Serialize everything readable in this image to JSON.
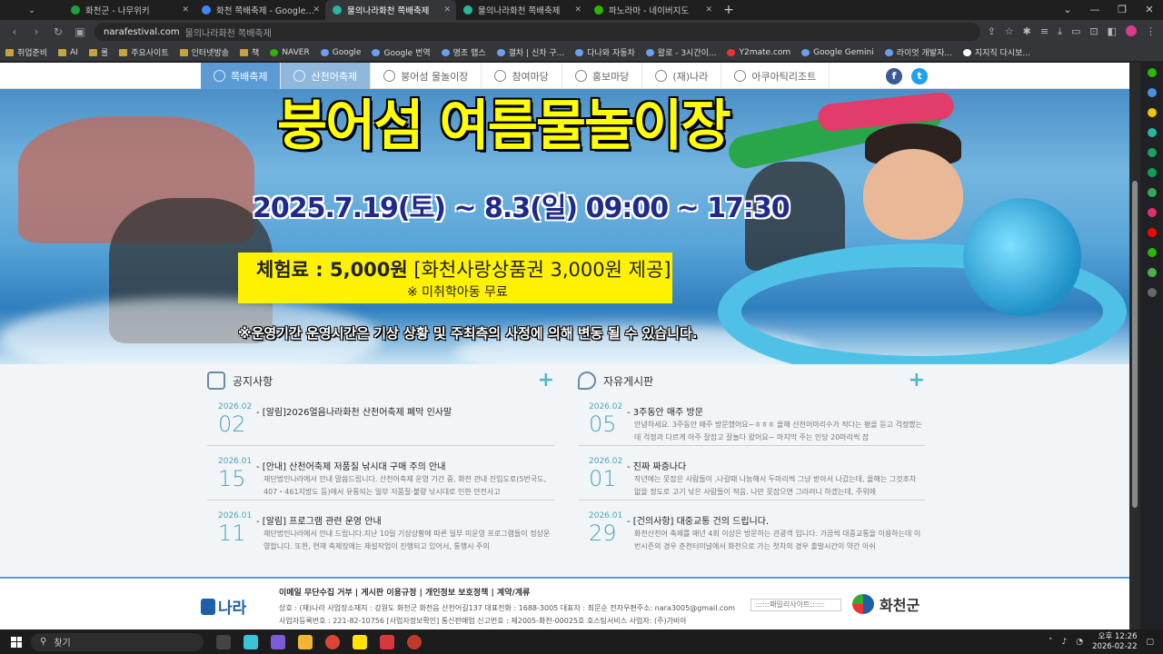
{
  "browser": {
    "tabs": [
      {
        "title": "화천군 - 나무위키",
        "color": "#18a33a",
        "active": false
      },
      {
        "title": "화천 쪽배축제 - Google 검색",
        "color": "#4285f4",
        "active": false
      },
      {
        "title": "물의나라화천 쪽배축제",
        "color": "#27b6a0",
        "active": true
      },
      {
        "title": "물의나라화천 쪽배축제",
        "color": "#27b6a0",
        "active": false
      },
      {
        "title": "파노라마 - 네이버지도",
        "color": "#2db400",
        "active": false
      }
    ],
    "new_tab": "+",
    "address": {
      "host": "narafestival.com",
      "path": "물의나라화천 쪽배축제"
    },
    "bookmarks": [
      "취업준비",
      "AI",
      "롤",
      "주요사이트",
      "인터넷방송",
      "책",
      "NAVER",
      "Google",
      "Google 번역",
      "명조 맵스",
      "갤차 | 신차 구...",
      "다나와 자동차",
      "왈로 - 3시간이...",
      "Y2mate.com",
      "Google Gemini",
      "라이엇 개발자...",
      "지지직 다시보..."
    ]
  },
  "site": {
    "nav": [
      {
        "label": "쪽배축제",
        "icon": "boat-icon"
      },
      {
        "label": "산천어축제",
        "icon": "fish-icon"
      },
      {
        "label": "붕어섬 물놀이장",
        "icon": "sun-icon"
      },
      {
        "label": "참여마당",
        "icon": "people-icon"
      },
      {
        "label": "홍보마당",
        "icon": "mic-icon"
      },
      {
        "label": "(재)나라",
        "icon": "building-icon"
      },
      {
        "label": "아쿠아틱리조트",
        "icon": "resort-icon"
      }
    ],
    "social": {
      "facebook": "f",
      "twitter": "t"
    },
    "hero": {
      "title": "붕어섬 여름물놀이장",
      "date": "2025.7.19(토) ~ 8.3(일) 09:00 ~ 17:30",
      "fee_bold": "체험료 : 5,000원",
      "fee_rest": " [화천사랑상품권 3,000원 제공]",
      "fee_note": "※ 미취학아동 무료",
      "notice": "※운영기간 운영시간은 기상 상황 및 주최측의 사정에 의해 변동 될 수 있습니다."
    },
    "notice_board": {
      "title": "공지사항",
      "plus": "+",
      "posts": [
        {
          "ym": "2026.02",
          "dd": "02",
          "title": "- [알림]2026얼음나라화천 산천어축제 폐막 인사말",
          "desc": ""
        },
        {
          "ym": "2026.01",
          "dd": "15",
          "title": "- [안내] 산천어축제 저품질 낚시대 구매 주의 안내",
          "desc": "재단법인나라에서 안내 말씀드립니다. 산천어축제 운영 기간 중, 화천 관내 진입도로(5번국도, 407・461지방도 등)에서 유통되는 일부 저품질·불량 낚시대로 인한 안전사고"
        },
        {
          "ym": "2026.01",
          "dd": "11",
          "title": "- [알림] 프로그램 관련 운영 안내",
          "desc": "재단법인나라에서 안내 드립니다.지난 10일 기상상황에 따른 일부 미운영 프로그램들이 정상운영합니다. 또한, 현재 축제장에는 제설작업이 진행되고 있어서, 통행시 주의"
        }
      ]
    },
    "free_board": {
      "title": "자유게시판",
      "plus": "+",
      "posts": [
        {
          "ym": "2026.02",
          "dd": "05",
          "title": "- 3주동안 매주 방문",
          "desc": "안녕하세요. 3주동안 매주 방문했어요~ㅎㅎㅎ 올해 산천어마리수가 적다는 평을 듣고 걱정했는데 걱정과 다르게 아주 잘잡고 잘놀다 왔어요~ 마지막 주는 인당 20마리씩 잡"
        },
        {
          "ym": "2026.02",
          "dd": "01",
          "title": "- 진짜 짜증나다",
          "desc": "작년에는 못잡은 사람들이 ,나갈때 나눔해서 두마리씩 그냥 받아서 나갔는데, 올해는 그것조차 없을 정도로 고기 낚은 사람들이 적음. 나만 못잡으면 그러려니 하겠는데, 주위에"
        },
        {
          "ym": "2026.01",
          "dd": "29",
          "title": "- [건의사항] 대중교통 건의 드립니다.",
          "desc": "화천산천어 축제를 매년 4회 이상은 방문하는 관광객 입니다. 가끔씩 대중교통을 이용하는데 이번시즌의 경우 춘천터미널에서 화천으로 가는 첫차의 경우 출발시간이 약간 아쉬"
        }
      ]
    },
    "footer": {
      "logo_text": "나라",
      "links": "이메일 무단수집 거부 | 게시판 이용규정 | 개인정보 보호정책 | 계약/계류",
      "info1": "상호 : (재)나라    사업장소재지 : 강원도 화천군 화천읍 산천어길137    대표전화 : 1688-3005    대표자 : 최문순    전자우편주소: nara3005@gmail.com",
      "info2": "사업자등록번호 : 221-82-10756 [사업자정보확인]    통신판매업 신고번호 : 제2005-화천-00025호    호스팅서비스 사업자: (주)가비아",
      "family_site": "::::::패밀리사이트::::::",
      "gov_text": "화천군"
    }
  },
  "taskbar": {
    "search_placeholder": "찾기",
    "time": "오후 12:26",
    "date": "2026-02-22"
  }
}
